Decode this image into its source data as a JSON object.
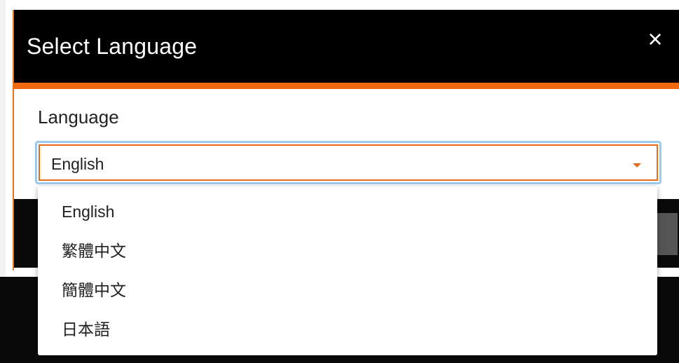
{
  "modal": {
    "title": "Select Language",
    "close_label": "×"
  },
  "field": {
    "label": "Language",
    "selected_value": "English"
  },
  "dropdown": {
    "options": [
      "English",
      "繁體中文",
      "簡體中文",
      "日本語"
    ]
  },
  "colors": {
    "accent": "#f26a10",
    "header_bg": "#000000",
    "focus_ring": "#9ecaf0"
  },
  "icons": {
    "close": "close-icon",
    "caret": "caret-down-icon"
  }
}
